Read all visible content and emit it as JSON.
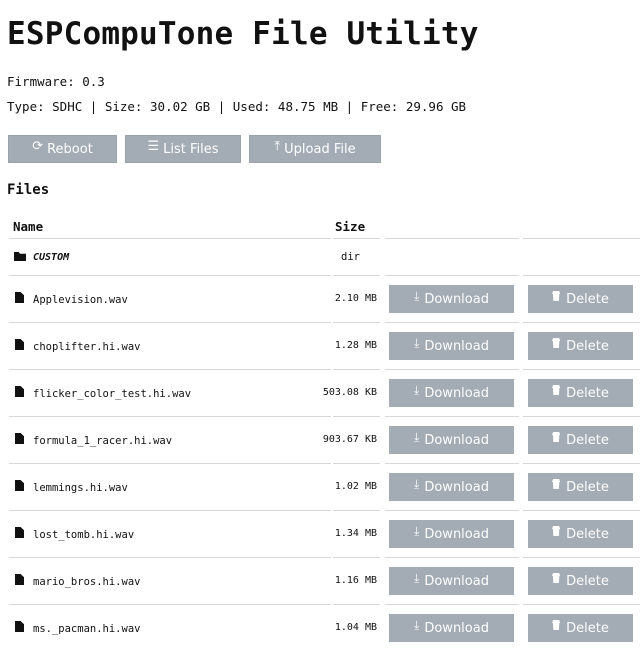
{
  "page_title": "ESPCompuTone File Utility",
  "firmware": "Firmware: 0.3",
  "stats": "Type: SDHC | Size: 30.02 GB | Used: 48.75 MB | Free: 29.96 GB",
  "toolbar": {
    "reboot_label": "Reboot",
    "list_label": "List Files",
    "upload_label": "Upload File",
    "reboot_icon": "refresh-icon",
    "list_icon": "list-icon",
    "upload_icon": "upload-icon"
  },
  "files_heading": "Files",
  "table": {
    "col_name": "Name",
    "col_size": "Size",
    "download_label": "Download",
    "delete_label": "Delete",
    "rows": [
      {
        "name": "CUSTOM",
        "size": "dir",
        "type": "dir"
      },
      {
        "name": "Applevision.wav",
        "size": "2.10 MB",
        "type": "file"
      },
      {
        "name": "choplifter.hi.wav",
        "size": "1.28 MB",
        "type": "file"
      },
      {
        "name": "flicker_color_test.hi.wav",
        "size": "503.08 KB",
        "type": "file"
      },
      {
        "name": "formula_1_racer.hi.wav",
        "size": "903.67 KB",
        "type": "file"
      },
      {
        "name": "lemmings.hi.wav",
        "size": "1.02 MB",
        "type": "file"
      },
      {
        "name": "lost_tomb.hi.wav",
        "size": "1.34 MB",
        "type": "file"
      },
      {
        "name": "mario_bros.hi.wav",
        "size": "1.16 MB",
        "type": "file"
      },
      {
        "name": "ms._pacman.hi.wav",
        "size": "1.04 MB",
        "type": "file"
      }
    ]
  },
  "colors": {
    "button_bg": "#a3abb5",
    "button_text": "#ffffff"
  }
}
